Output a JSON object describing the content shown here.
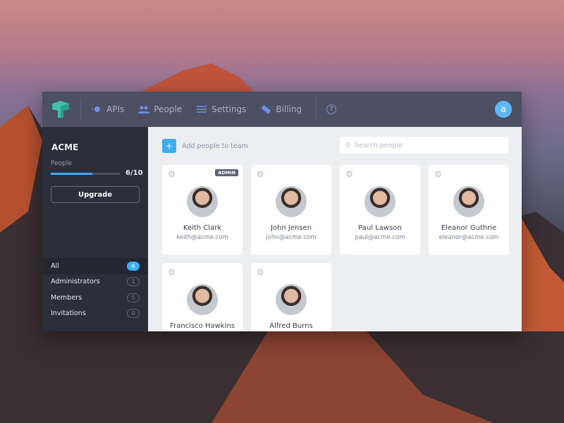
{
  "header": {
    "nav": [
      {
        "label": "APIs",
        "icon": "api-icon"
      },
      {
        "label": "People",
        "icon": "people-icon"
      },
      {
        "label": "Settings",
        "icon": "sliders-icon"
      },
      {
        "label": "Billing",
        "icon": "ticket-icon"
      }
    ],
    "help": "?",
    "avatar_letter": "a"
  },
  "sidebar": {
    "org": "ACME",
    "people_label": "People",
    "usage": "6/10",
    "usage_fraction": 0.6,
    "upgrade": "Upgrade",
    "filters": [
      {
        "label": "All",
        "count": "6"
      },
      {
        "label": "Administrators",
        "count": "1"
      },
      {
        "label": "Members",
        "count": "5"
      },
      {
        "label": "Invitations",
        "count": "0"
      }
    ]
  },
  "main": {
    "add_label": "Add people to team",
    "search_placeholder": "Search people",
    "people": [
      {
        "name": "Keith Clark",
        "email": "keith@acme.com",
        "badge": "ADMIN"
      },
      {
        "name": "John Jensen",
        "email": "john@acme.com"
      },
      {
        "name": "Paul Lawson",
        "email": "paul@acme.com"
      },
      {
        "name": "Eleanor Guthrie",
        "email": "eleanor@acme.com"
      },
      {
        "name": "Francisco Hawkins",
        "email": ""
      },
      {
        "name": "Alfred Burns",
        "email": ""
      }
    ]
  },
  "colors": {
    "accent": "#3aaef0",
    "header": "#4b5063",
    "sidebar": "#2b2e3b"
  }
}
